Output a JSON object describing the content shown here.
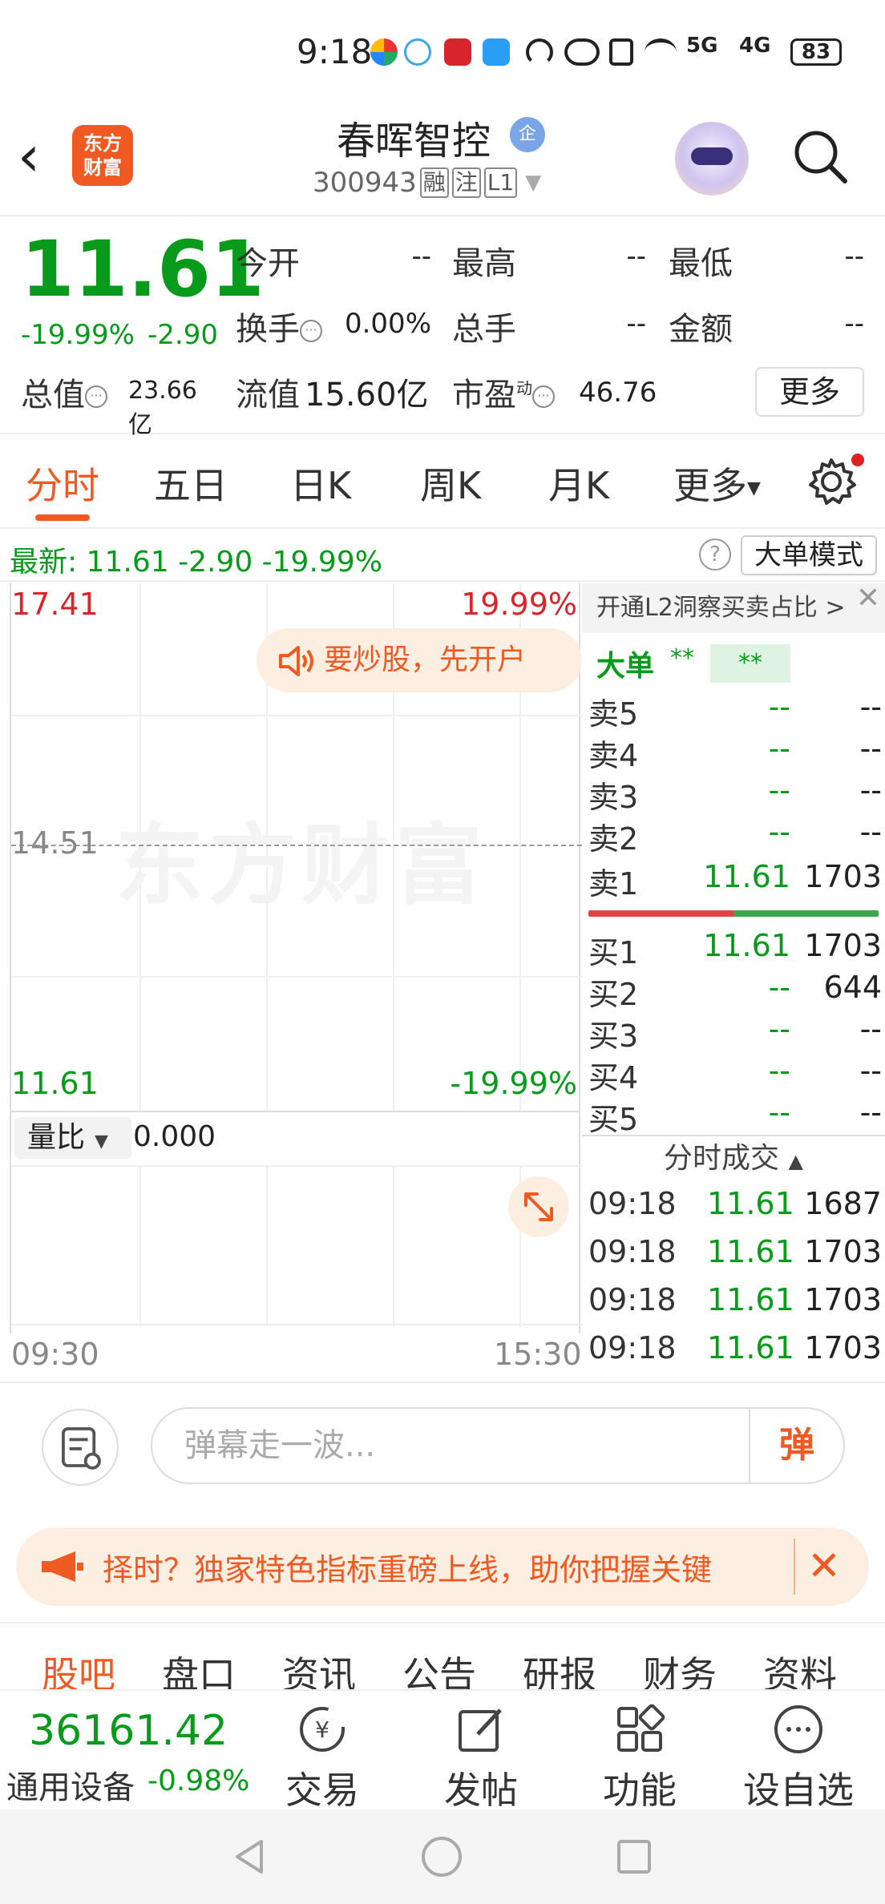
{
  "status": {
    "time": "9:18",
    "battery": "83",
    "net1": "5G",
    "net2": "4G"
  },
  "header": {
    "stock_name": "春晖智控",
    "ent_badge": "企",
    "stock_code": "300943",
    "tag_rong": "融",
    "tag_zhu": "注",
    "tag_level": "L1",
    "logo_line1": "东方",
    "logo_line2": "财富"
  },
  "quote": {
    "price": "11.61",
    "change_pct": "-19.99%",
    "change_amt": "-2.90",
    "open_label": "今开",
    "open_val": "--",
    "high_label": "最高",
    "high_val": "--",
    "low_label": "最低",
    "low_val": "--",
    "turnover_label": "换手",
    "turnover_val": "0.00%",
    "volume_label": "总手",
    "volume_val": "--",
    "amount_label": "金额",
    "amount_val": "--",
    "mktcap_label": "总值",
    "mktcap_val": "23.66亿",
    "float_label": "流值",
    "float_val": "15.60亿",
    "pe_label": "市盈",
    "pe_sup": "动",
    "pe_val": "46.76",
    "more_label": "更多"
  },
  "tabs": [
    "分时",
    "五日",
    "日K",
    "周K",
    "月K",
    "更多"
  ],
  "latest": {
    "text": "最新:  11.61  -2.90  -19.99%",
    "mode_btn": "大单模式",
    "help": "?"
  },
  "chart": {
    "top_price": "17.41",
    "top_pct": "19.99%",
    "mid_price": "14.51",
    "bottom_price": "11.61",
    "bottom_pct": "-19.99%",
    "watermark": "东方财富",
    "promo": "要炒股，先开户",
    "vol_selector": "量比",
    "vol_value": "0.000",
    "time_start": "09:30",
    "time_end": "15:30"
  },
  "book": {
    "l2_text": "开通L2洞察买卖占比 >",
    "big_order": "大单",
    "big_stars1": "**",
    "big_stars2": "**",
    "asks": [
      {
        "label": "卖5",
        "price": "--",
        "vol": "--"
      },
      {
        "label": "卖4",
        "price": "--",
        "vol": "--"
      },
      {
        "label": "卖3",
        "price": "--",
        "vol": "--"
      },
      {
        "label": "卖2",
        "price": "--",
        "vol": "--"
      },
      {
        "label": "卖1",
        "price": "11.61",
        "vol": "1703"
      }
    ],
    "bids": [
      {
        "label": "买1",
        "price": "11.61",
        "vol": "1703"
      },
      {
        "label": "买2",
        "price": "--",
        "vol": "644"
      },
      {
        "label": "买3",
        "price": "--",
        "vol": "--"
      },
      {
        "label": "买4",
        "price": "--",
        "vol": "--"
      },
      {
        "label": "买5",
        "price": "--",
        "vol": "--"
      }
    ],
    "trades_header": "分时成交",
    "trades": [
      {
        "time": "09:18",
        "price": "11.61",
        "vol": "1687"
      },
      {
        "time": "09:18",
        "price": "11.61",
        "vol": "1703"
      },
      {
        "time": "09:18",
        "price": "11.61",
        "vol": "1703"
      },
      {
        "time": "09:18",
        "price": "11.61",
        "vol": "1703"
      }
    ]
  },
  "danmaku": {
    "placeholder": "弹幕走一波...",
    "btn": "弹"
  },
  "banner": {
    "text": "择时？独家特色指标重磅上线，助你把握关键"
  },
  "subtabs": [
    "股吧",
    "盘口",
    "资讯",
    "公告",
    "研报",
    "财务",
    "资料"
  ],
  "bottom": {
    "index_value": "36161.42",
    "index_name": "通用设备",
    "index_change": "-0.98%",
    "nav": [
      "交易",
      "发帖",
      "功能",
      "设自选"
    ]
  },
  "colors": {
    "accent": "#ef5a22",
    "down": "#079a1b",
    "up": "#d8252b"
  }
}
